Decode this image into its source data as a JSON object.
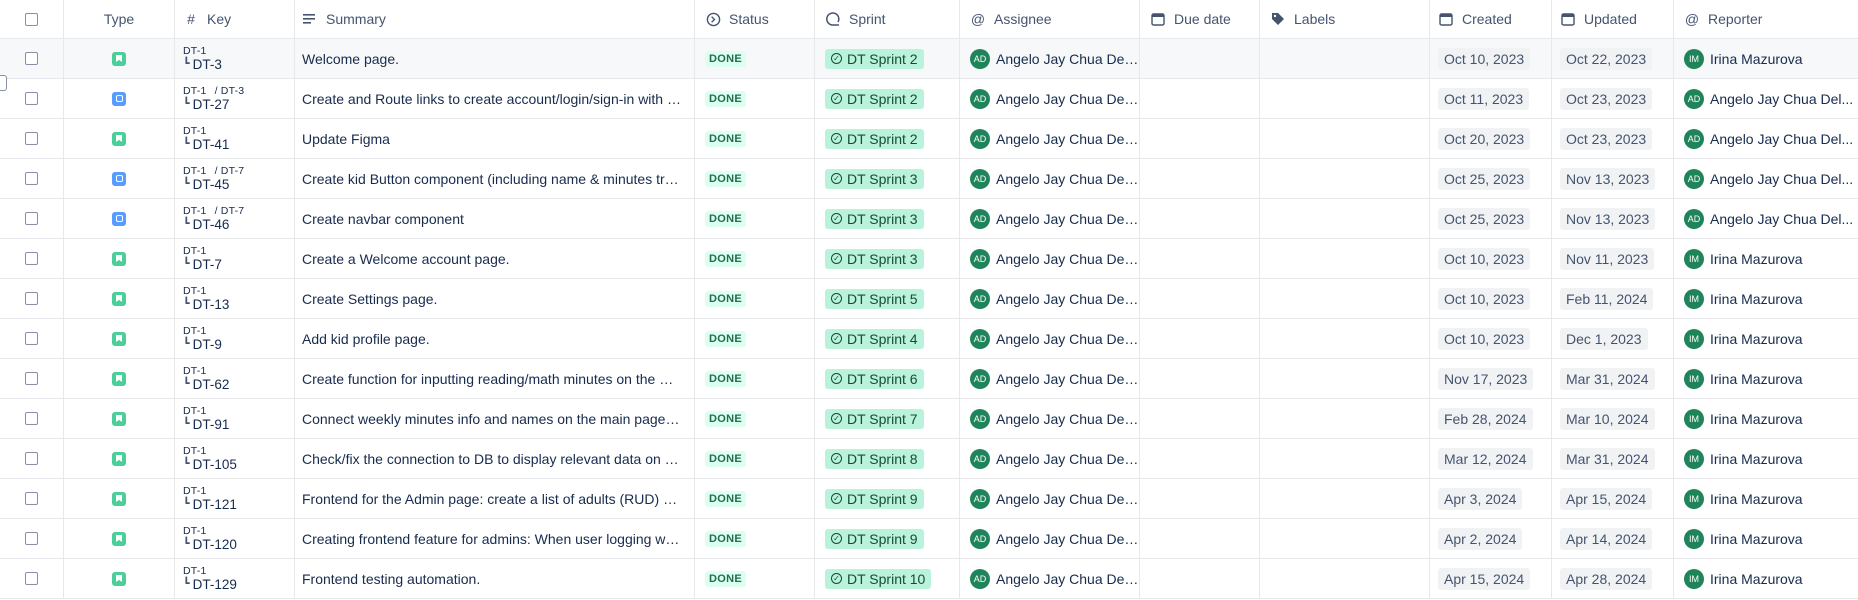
{
  "columns": {
    "type": "Type",
    "key": "Key",
    "summary": "Summary",
    "status": "Status",
    "sprint": "Sprint",
    "assignee": "Assignee",
    "due_date": "Due date",
    "labels": "Labels",
    "created": "Created",
    "updated": "Updated",
    "reporter": "Reporter"
  },
  "rows": [
    {
      "type": "story",
      "parent": "DT-1",
      "parent2": "",
      "key": "DT-3",
      "summary": "Welcome page.",
      "status": "DONE",
      "sprint": "DT Sprint 2",
      "assignee_initials": "AD",
      "assignee": "Angelo Jay Chua Del...",
      "due": "",
      "labels": "",
      "created": "Oct 10, 2023",
      "updated": "Oct 22, 2023",
      "reporter_initials": "IM",
      "reporter": "Irina Mazurova"
    },
    {
      "type": "subtask",
      "parent": "DT-1",
      "parent2": "/ DT-3",
      "key": "DT-27",
      "summary": "Create and Route links to create account/login/sign-in with g...",
      "status": "DONE",
      "sprint": "DT Sprint 2",
      "assignee_initials": "AD",
      "assignee": "Angelo Jay Chua Del...",
      "due": "",
      "labels": "",
      "created": "Oct 11, 2023",
      "updated": "Oct 23, 2023",
      "reporter_initials": "AD",
      "reporter": "Angelo Jay Chua Del..."
    },
    {
      "type": "story",
      "parent": "DT-1",
      "parent2": "",
      "key": "DT-41",
      "summary": "Update Figma",
      "status": "DONE",
      "sprint": "DT Sprint 2",
      "assignee_initials": "AD",
      "assignee": "Angelo Jay Chua Del...",
      "due": "",
      "labels": "",
      "created": "Oct 20, 2023",
      "updated": "Oct 23, 2023",
      "reporter_initials": "AD",
      "reporter": "Angelo Jay Chua Del..."
    },
    {
      "type": "subtask",
      "parent": "DT-1",
      "parent2": "/ DT-7",
      "key": "DT-45",
      "summary": "Create kid Button component (including name & minutes tra...",
      "status": "DONE",
      "sprint": "DT Sprint 3",
      "assignee_initials": "AD",
      "assignee": "Angelo Jay Chua Del...",
      "due": "",
      "labels": "",
      "created": "Oct 25, 2023",
      "updated": "Nov 13, 2023",
      "reporter_initials": "AD",
      "reporter": "Angelo Jay Chua Del..."
    },
    {
      "type": "subtask",
      "parent": "DT-1",
      "parent2": "/ DT-7",
      "key": "DT-46",
      "summary": "Create navbar component",
      "status": "DONE",
      "sprint": "DT Sprint 3",
      "assignee_initials": "AD",
      "assignee": "Angelo Jay Chua Del...",
      "due": "",
      "labels": "",
      "created": "Oct 25, 2023",
      "updated": "Nov 13, 2023",
      "reporter_initials": "AD",
      "reporter": "Angelo Jay Chua Del..."
    },
    {
      "type": "story",
      "parent": "DT-1",
      "parent2": "",
      "key": "DT-7",
      "summary": "Create a Welcome account page.",
      "status": "DONE",
      "sprint": "DT Sprint 3",
      "assignee_initials": "AD",
      "assignee": "Angelo Jay Chua Del...",
      "due": "",
      "labels": "",
      "created": "Oct 10, 2023",
      "updated": "Nov 11, 2023",
      "reporter_initials": "IM",
      "reporter": "Irina Mazurova"
    },
    {
      "type": "story",
      "parent": "DT-1",
      "parent2": "",
      "key": "DT-13",
      "summary": "Create Settings page.",
      "status": "DONE",
      "sprint": "DT Sprint 5",
      "assignee_initials": "AD",
      "assignee": "Angelo Jay Chua Del...",
      "due": "",
      "labels": "",
      "created": "Oct 10, 2023",
      "updated": "Feb 11, 2024",
      "reporter_initials": "IM",
      "reporter": "Irina Mazurova"
    },
    {
      "type": "story",
      "parent": "DT-1",
      "parent2": "",
      "key": "DT-9",
      "summary": "Add kid profile page.",
      "status": "DONE",
      "sprint": "DT Sprint 4",
      "assignee_initials": "AD",
      "assignee": "Angelo Jay Chua Del...",
      "due": "",
      "labels": "",
      "created": "Oct 10, 2023",
      "updated": "Dec 1, 2023",
      "reporter_initials": "IM",
      "reporter": "Irina Mazurova"
    },
    {
      "type": "story",
      "parent": "DT-1",
      "parent2": "",
      "key": "DT-62",
      "summary": "Create function for inputting reading/math minutes on the Ki...",
      "status": "DONE",
      "sprint": "DT Sprint 6",
      "assignee_initials": "AD",
      "assignee": "Angelo Jay Chua Del...",
      "due": "",
      "labels": "",
      "created": "Nov 17, 2023",
      "updated": "Mar 31, 2024",
      "reporter_initials": "IM",
      "reporter": "Irina Mazurova"
    },
    {
      "type": "story",
      "parent": "DT-1",
      "parent2": "",
      "key": "DT-91",
      "summary": "Connect weekly minutes info and names on the main page to...",
      "status": "DONE",
      "sprint": "DT Sprint 7",
      "assignee_initials": "AD",
      "assignee": "Angelo Jay Chua Del...",
      "due": "",
      "labels": "",
      "created": "Feb 28, 2024",
      "updated": "Mar 10, 2024",
      "reporter_initials": "IM",
      "reporter": "Irina Mazurova"
    },
    {
      "type": "story",
      "parent": "DT-1",
      "parent2": "",
      "key": "DT-105",
      "summary": "Check/fix the connection to DB to display relevant data on th...",
      "status": "DONE",
      "sprint": "DT Sprint 8",
      "assignee_initials": "AD",
      "assignee": "Angelo Jay Chua Del...",
      "due": "",
      "labels": "",
      "created": "Mar 12, 2024",
      "updated": "Mar 31, 2024",
      "reporter_initials": "IM",
      "reporter": "Irina Mazurova"
    },
    {
      "type": "story",
      "parent": "DT-1",
      "parent2": "",
      "key": "DT-121",
      "summary": "Frontend for the Admin page: create a list of adults (RUD) an...",
      "status": "DONE",
      "sprint": "DT Sprint 9",
      "assignee_initials": "AD",
      "assignee": "Angelo Jay Chua Del...",
      "due": "",
      "labels": "",
      "created": "Apr 3, 2024",
      "updated": "Apr 15, 2024",
      "reporter_initials": "IM",
      "reporter": "Irina Mazurova"
    },
    {
      "type": "story",
      "parent": "DT-1",
      "parent2": "",
      "key": "DT-120",
      "summary": "Creating frontend feature for admins: When user logging wit...",
      "status": "DONE",
      "sprint": "DT Sprint 9",
      "assignee_initials": "AD",
      "assignee": "Angelo Jay Chua Del...",
      "due": "",
      "labels": "",
      "created": "Apr 2, 2024",
      "updated": "Apr 14, 2024",
      "reporter_initials": "IM",
      "reporter": "Irina Mazurova"
    },
    {
      "type": "story",
      "parent": "DT-1",
      "parent2": "",
      "key": "DT-129",
      "summary": "Frontend testing automation.",
      "status": "DONE",
      "sprint": "DT Sprint 10",
      "assignee_initials": "AD",
      "assignee": "Angelo Jay Chua Del...",
      "due": "",
      "labels": "",
      "created": "Apr 15, 2024",
      "updated": "Apr 28, 2024",
      "reporter_initials": "IM",
      "reporter": "Irina Mazurova"
    }
  ],
  "icons": {
    "story": "story-icon",
    "subtask": "subtask-icon"
  },
  "colors": {
    "status_done_bg": "#dcfff1",
    "status_done_text": "#216e4e",
    "sprint_bg": "#baf3db",
    "avatar": "#1f845a"
  }
}
